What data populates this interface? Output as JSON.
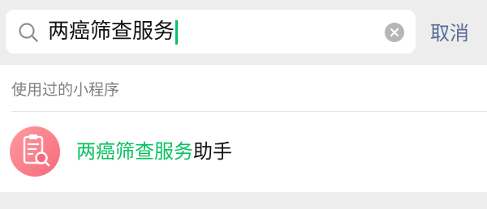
{
  "search": {
    "query": "两癌筛查服务",
    "cancel_label": "取消",
    "search_icon": "search-icon",
    "clear_icon": "clear-icon"
  },
  "results": {
    "section_header": "使用过的小程序",
    "items": [
      {
        "title_highlight": "两癌筛查服务",
        "title_rest": "助手",
        "icon": "mini-program-document-icon"
      }
    ]
  },
  "colors": {
    "highlight": "#07c160",
    "cancel": "#576b95",
    "app_icon_gradient": [
      "#ff9a9e",
      "#f56b7d"
    ]
  }
}
